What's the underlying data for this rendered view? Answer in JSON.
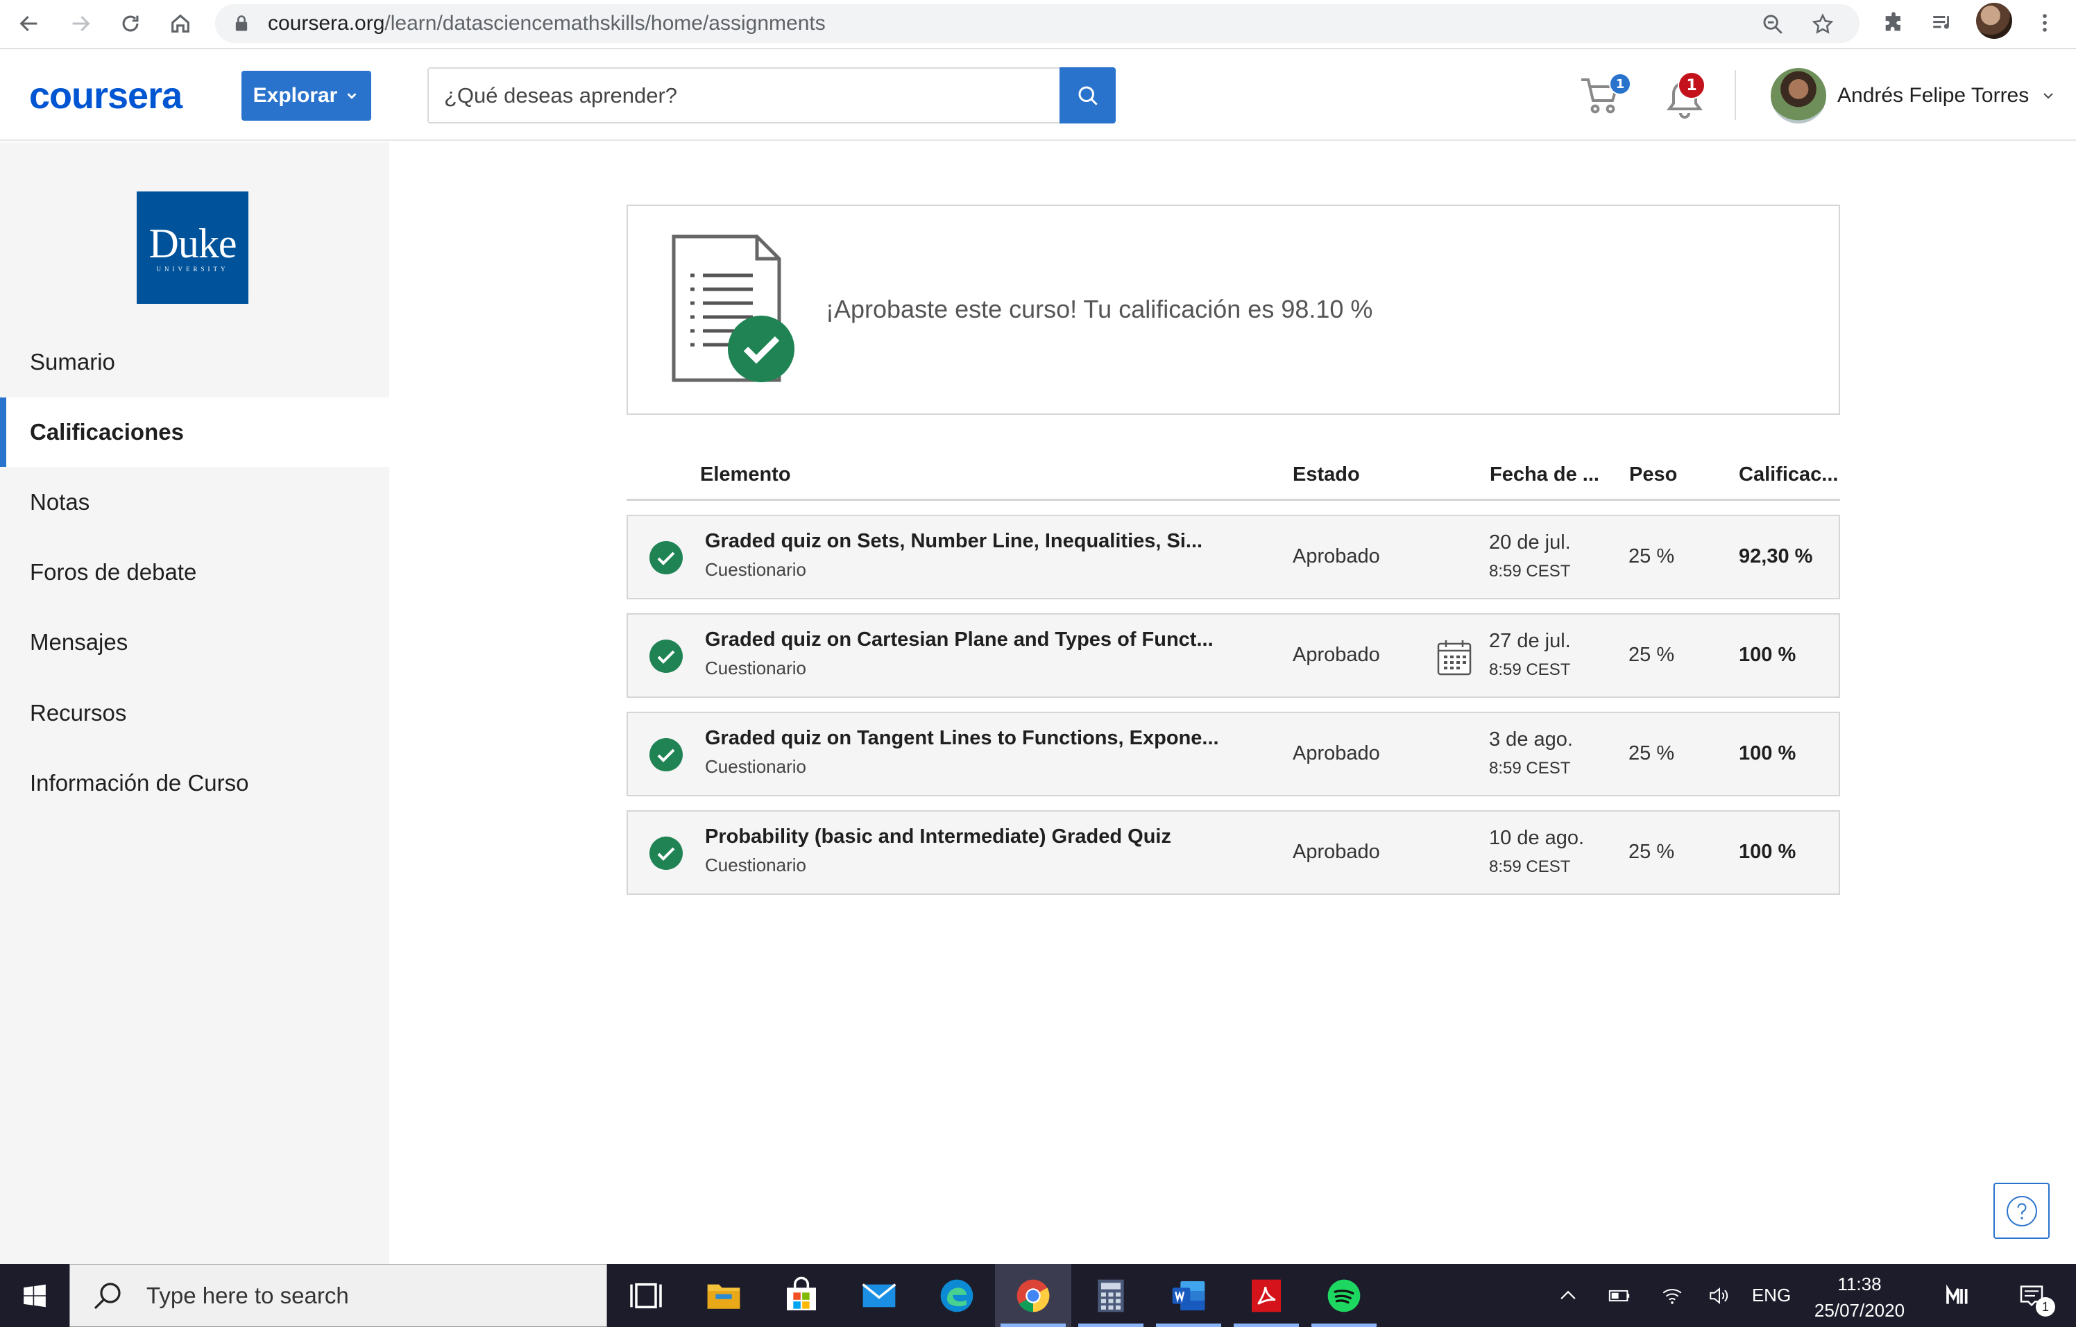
{
  "browser": {
    "url_host": "coursera.org",
    "url_path": "/learn/datasciencemathskills/home/assignments"
  },
  "header": {
    "logo": "coursera",
    "explore_label": "Explorar",
    "search_placeholder": "¿Qué deseas aprender?",
    "cart_count": "1",
    "notification_count": "1",
    "user_name": "Andrés Felipe Torres"
  },
  "sidebar": {
    "university_name": "Duke",
    "university_sub": "UNIVERSITY",
    "items": [
      {
        "label": "Sumario",
        "active": false
      },
      {
        "label": "Calificaciones",
        "active": true
      },
      {
        "label": "Notas",
        "active": false
      },
      {
        "label": "Foros de debate",
        "active": false
      },
      {
        "label": "Mensajes",
        "active": false
      },
      {
        "label": "Recursos",
        "active": false
      },
      {
        "label": "Información de Curso",
        "active": false
      }
    ]
  },
  "banner": {
    "message": "¡Aprobaste este curso! Tu calificación es 98.10 %"
  },
  "table": {
    "headers": {
      "item": "Elemento",
      "status": "Estado",
      "due": "Fecha de ...",
      "weight": "Peso",
      "grade": "Calificac..."
    },
    "rows": [
      {
        "title": "Graded quiz on Sets, Number Line, Inequalities, Si...",
        "type": "Cuestionario",
        "status": "Aprobado",
        "date": "20 de jul.",
        "time": "8:59 CEST",
        "weight": "25 %",
        "grade": "92,30 %",
        "calendar_icon": false
      },
      {
        "title": "Graded quiz on Cartesian Plane and Types of Funct...",
        "type": "Cuestionario",
        "status": "Aprobado",
        "date": "27 de jul.",
        "time": "8:59 CEST",
        "weight": "25 %",
        "grade": "100 %",
        "calendar_icon": true
      },
      {
        "title": "Graded quiz on Tangent Lines to Functions, Expone...",
        "type": "Cuestionario",
        "status": "Aprobado",
        "date": "3 de ago.",
        "time": "8:59 CEST",
        "weight": "25 %",
        "grade": "100 %",
        "calendar_icon": false
      },
      {
        "title": "Probability (basic and Intermediate) Graded Quiz",
        "type": "Cuestionario",
        "status": "Aprobado",
        "date": "10 de ago.",
        "time": "8:59 CEST",
        "weight": "25 %",
        "grade": "100 %",
        "calendar_icon": false
      }
    ]
  },
  "taskbar": {
    "search_text": "Type here to search",
    "language": "ENG",
    "time": "11:38",
    "date": "25/07/2020",
    "action_center_count": "1"
  },
  "colors": {
    "accent": "#2a73cc",
    "success": "#1f8354",
    "sidebar_bg": "#f5f5f5",
    "taskbar_bg": "#1c1c2b"
  }
}
